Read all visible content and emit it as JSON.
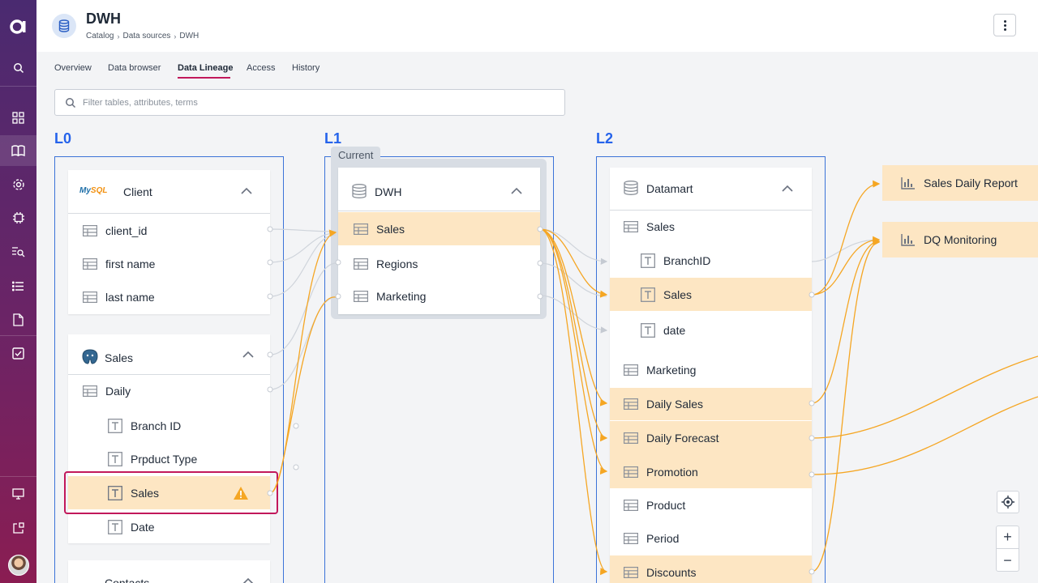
{
  "sidebar": {
    "logo": "a",
    "icons": [
      "search-icon",
      "dashboard-icon",
      "book-icon",
      "gear-icon",
      "chip-icon",
      "query-icon",
      "list-icon",
      "document-icon",
      "checkbox-icon",
      "monitor-icon",
      "share-icon"
    ]
  },
  "header": {
    "title": "DWH",
    "breadcrumb": [
      "Catalog",
      "Data sources",
      "DWH"
    ]
  },
  "tabs": [
    "Overview",
    "Data browser",
    "Data Lineage",
    "Access",
    "History"
  ],
  "active_tab": "Data Lineage",
  "search": {
    "placeholder": "Filter tables, attributes, terms",
    "value": ""
  },
  "levels": {
    "l0": {
      "label": "L0",
      "client": {
        "title": "Client",
        "rows": [
          "client_id",
          "first name",
          "last name"
        ]
      },
      "sales": {
        "title": "Sales",
        "table": "Daily",
        "attrs": [
          "Branch ID",
          "Prpduct Type",
          "Sales",
          "Date"
        ]
      },
      "third_card": "Contacts"
    },
    "l1": {
      "label": "L1",
      "current_tag": "Current",
      "dwh": {
        "title": "DWH",
        "rows": [
          "Sales",
          "Regions",
          "Marketing"
        ]
      }
    },
    "l2": {
      "label": "L2",
      "datamart": {
        "title": "Datamart",
        "rows": [
          "Sales",
          "BranchID",
          "Sales",
          "date",
          "Marketing",
          "Daily Sales",
          "Daily Forecast",
          "Promotion",
          "Product",
          "Period",
          "Discounts"
        ]
      }
    },
    "l3": {
      "reports": [
        "Sales Daily Report",
        "DQ Monitoring"
      ]
    }
  },
  "zoom": {
    "in": "+",
    "out": "−"
  },
  "colors": {
    "accent": "#c2185b",
    "level": "#2563eb",
    "highlight": "#fde6c3",
    "lineage": "#f5a623"
  }
}
